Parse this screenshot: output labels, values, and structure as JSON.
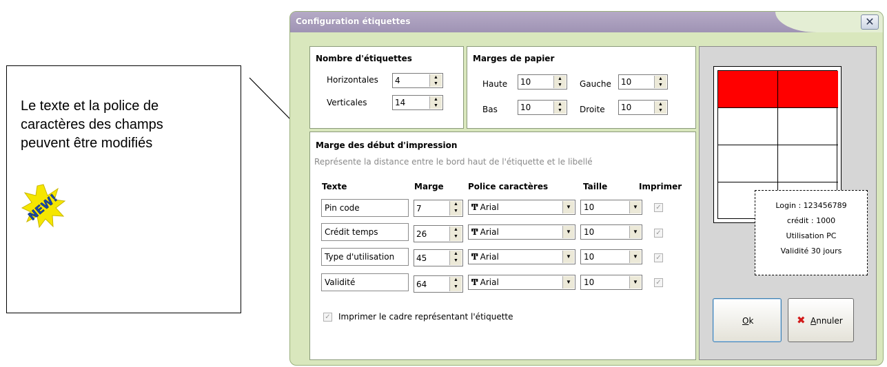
{
  "annotation": {
    "text_lines": [
      "Le texte et la police de",
      "caractères des champs",
      "peuvent être modifiés"
    ],
    "badge_text": "NEW!"
  },
  "window": {
    "title": "Configuration étiquettes",
    "close_glyph": "✕"
  },
  "nombre": {
    "title": "Nombre d'étiquettes",
    "horizontales_label": "Horizontales",
    "horizontales_value": "4",
    "verticales_label": "Verticales",
    "verticales_value": "14"
  },
  "marges": {
    "title": "Marges de papier",
    "haute_label": "Haute",
    "haute_value": "10",
    "bas_label": "Bas",
    "bas_value": "10",
    "gauche_label": "Gauche",
    "gauche_value": "10",
    "droite_label": "Droite",
    "droite_value": "10"
  },
  "impression": {
    "title": "Marge des début d'impression",
    "subtitle": "Représente la distance entre le bord haut de l'étiquette et le libellé",
    "headers": {
      "texte": "Texte",
      "marge": "Marge",
      "police": "Police caractères",
      "taille": "Taille",
      "imprimer": "Imprimer"
    },
    "rows": [
      {
        "texte": "Pin code",
        "marge": "7",
        "police": "Arial",
        "taille": "10",
        "imprimer": true
      },
      {
        "texte": "Crédit temps",
        "marge": "26",
        "police": "Arial",
        "taille": "10",
        "imprimer": true
      },
      {
        "texte": "Type d'utilisation",
        "marge": "45",
        "police": "Arial",
        "taille": "10",
        "imprimer": true
      },
      {
        "texte": "Validité",
        "marge": "64",
        "police": "Arial",
        "taille": "10",
        "imprimer": true
      }
    ],
    "font_icon": "truetype-icon",
    "cadre_label": "Imprimer le cadre représentant l'étiquette",
    "cadre_checked": true
  },
  "preview": {
    "lines": [
      "Login : 123456789",
      "crédit : 1000",
      "Utilisation PC",
      "Validité 30 jours"
    ],
    "highlight_color": "#ff0000",
    "rows": 4,
    "cols": 2
  },
  "buttons": {
    "ok_label": "Ok",
    "ok_mnemonic": "O",
    "ok_rest": "k",
    "annuler_label": "Annuler",
    "annuler_mnemonic": "A",
    "annuler_rest": "nnuler"
  },
  "colors": {
    "window_bg": "#d9e7bd",
    "title_bar": "#a89cbc",
    "accent_red": "#ff0000"
  }
}
